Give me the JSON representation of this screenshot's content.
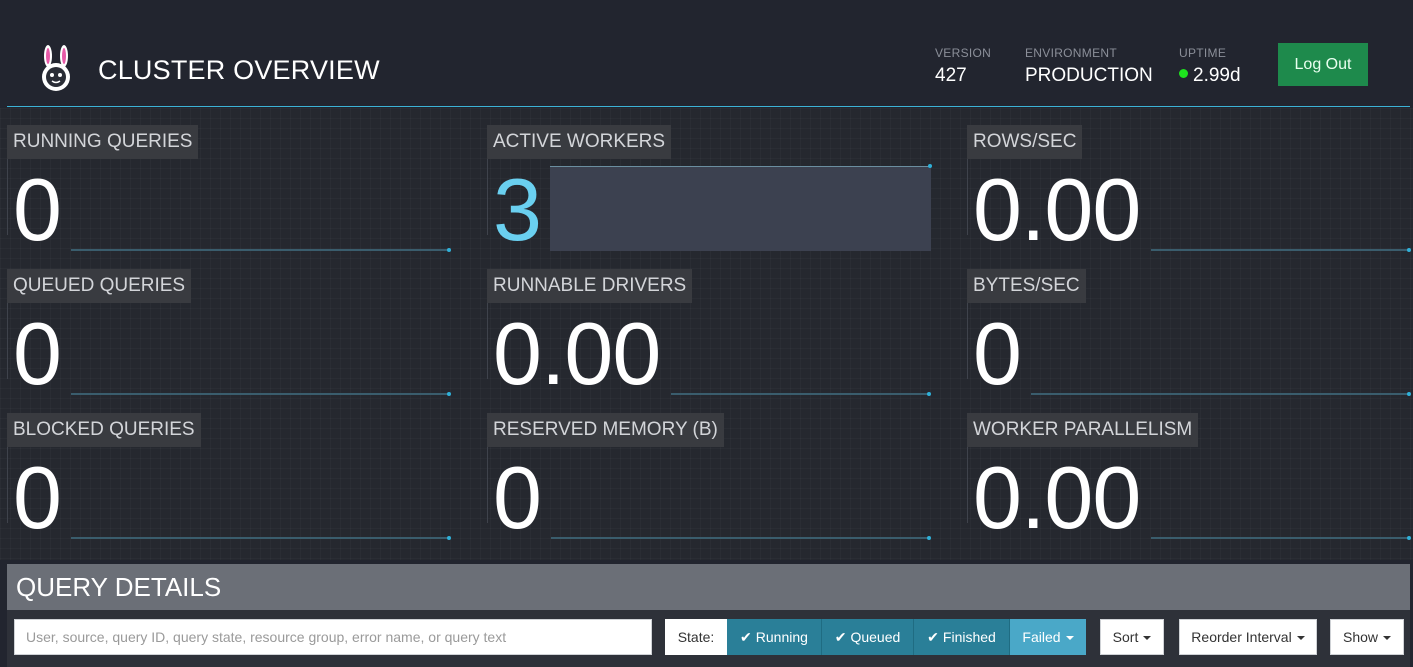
{
  "header": {
    "title": "CLUSTER OVERVIEW",
    "version_label": "VERSION",
    "version_value": "427",
    "environment_label": "ENVIRONMENT",
    "environment_value": "PRODUCTION",
    "uptime_label": "UPTIME",
    "uptime_value": "2.99d",
    "logout_label": "Log Out"
  },
  "stats": {
    "running_queries": {
      "label": "RUNNING QUERIES",
      "value": "0"
    },
    "active_workers": {
      "label": "ACTIVE WORKERS",
      "value": "3"
    },
    "rows_sec": {
      "label": "ROWS/SEC",
      "value": "0.00"
    },
    "queued_queries": {
      "label": "QUEUED QUERIES",
      "value": "0"
    },
    "runnable_drivers": {
      "label": "RUNNABLE DRIVERS",
      "value": "0.00"
    },
    "bytes_sec": {
      "label": "BYTES/SEC",
      "value": "0"
    },
    "blocked_queries": {
      "label": "BLOCKED QUERIES",
      "value": "0"
    },
    "reserved_memory": {
      "label": "RESERVED MEMORY (B)",
      "value": "0"
    },
    "worker_parallelism": {
      "label": "WORKER PARALLELISM",
      "value": "0.00"
    }
  },
  "query_details": {
    "title": "QUERY DETAILS",
    "search_placeholder": "User, source, query ID, query state, resource group, error name, or query text",
    "state_label": "State:",
    "filters": {
      "running": "Running",
      "queued": "Queued",
      "finished": "Finished",
      "failed": "Failed"
    },
    "sort_label": "Sort",
    "reorder_label": "Reorder Interval",
    "show_label": "Show"
  },
  "colors": {
    "accent": "#3cb3d6",
    "logout": "#1e8a4c",
    "uptime_dot": "#1ee31e",
    "filter_active": "#2a7f98",
    "filter_failed": "#4aa8c8"
  }
}
